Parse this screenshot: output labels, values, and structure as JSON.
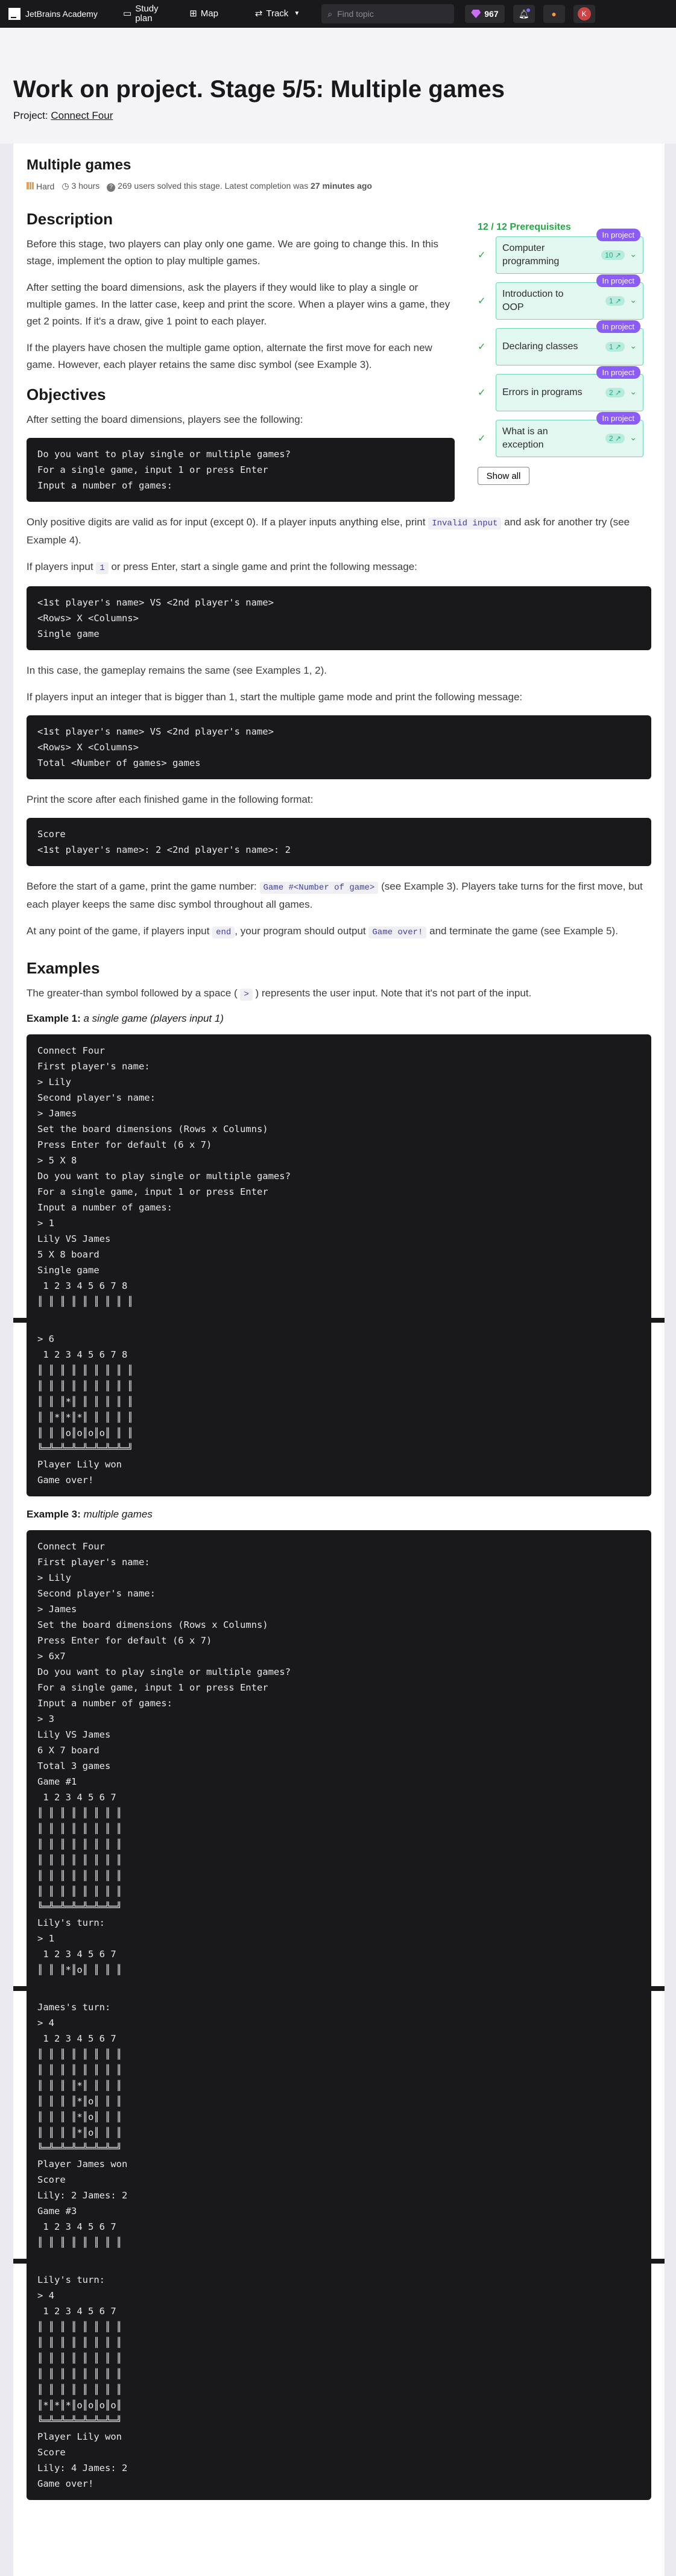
{
  "topbar": {
    "logo": "JetBrains Academy",
    "nav": [
      {
        "icon": "book-icon",
        "label": "Study plan"
      },
      {
        "icon": "grid-icon",
        "label": "Map"
      },
      {
        "icon": "track-icon",
        "label": "Track"
      }
    ],
    "search_placeholder": "Find topic",
    "gems": "967"
  },
  "header": {
    "title": "Work on project. Stage 5/5: Multiple games",
    "project_prefix": "Project:",
    "project_link": "Connect Four"
  },
  "stage": {
    "title": "Multiple games",
    "difficulty": "Hard",
    "time": "3 hours",
    "solved": "269 users solved this stage. Latest completion was",
    "latest": "27 minutes ago"
  },
  "prereq": {
    "title": "12 / 12 Prerequisites",
    "items": [
      {
        "name": "Computer programming",
        "tag": "In project",
        "pill": "10 ↗"
      },
      {
        "name": "Introduction to OOP",
        "tag": "In project",
        "pill": "1 ↗"
      },
      {
        "name": "Declaring classes",
        "tag": "In project",
        "pill": "1 ↗"
      },
      {
        "name": "Errors in programs",
        "tag": "In project",
        "pill": "2 ↗"
      },
      {
        "name": "What is an exception",
        "tag": "In project",
        "pill": "2 ↗"
      }
    ],
    "show_all": "Show all"
  },
  "description": {
    "heading": "Description",
    "p1": "Before this stage, two players can play only one game. We are going to change this. In this stage, implement the option to play multiple games.",
    "p2": "After setting the board dimensions, ask the players if they would like to play a single or multiple games. In the latter case, keep and print the score. When a player wins a game, they get 2 points. If it's a draw, give 1 point to each player.",
    "p3": "If the players have chosen the multiple game option, alternate the first move for each new game. However, each player retains the same disc symbol (see Example 3)."
  },
  "objectives": {
    "heading": "Objectives",
    "p1": "After setting the board dimensions, players see the following:",
    "code1": "Do you want to play single or multiple games?\nFor a single game, input 1 or press Enter\nInput a number of games:",
    "p2a": "Only positive digits are valid as for input (except 0). If a player inputs anything else, print",
    "p2code": "Invalid input",
    "p2b": "and ask for another try (see Example 4).",
    "p3a": "If players input",
    "p3code": "1",
    "p3b": "or press Enter, start a single game and print the following message:",
    "code2": "<1st player's name> VS <2nd player's name>\n<Rows> X <Columns>\nSingle game",
    "p4": "In this case, the gameplay remains the same (see Examples 1, 2).",
    "p5": "If players input an integer that is bigger than 1, start the multiple game mode and print the following message:",
    "code3": "<1st player's name> VS <2nd player's name>\n<Rows> X <Columns>\nTotal <Number of games> games",
    "p6": "Print the score after each finished game in the following format:",
    "code4": "Score\n<1st player's name>: 2 <2nd player's name>: 2",
    "p7a": "Before the start of a game, print the game number:",
    "p7code": "Game #<Number of game>",
    "p7b": "(see Example 3). Players take turns for the first move, but each player keeps the same disc symbol throughout all games.",
    "p8a": "At any point of the game, if players input",
    "p8code": "end",
    "p8b": ", your program should output",
    "p8code2": "Game over!",
    "p8c": "and terminate the game (see Example 5)."
  },
  "examples": {
    "heading": "Examples",
    "p1a": "The greater-than symbol followed by a space (",
    "p1code": ">",
    "p1b": ") represents the user input. Note that it's not part of the input.",
    "ex1_label": "Example 1:",
    "ex1_desc": "a single game (players input 1)",
    "ex1_code_a": "Connect Four\nFirst player's name:\n> Lily\nSecond player's name:\n> James\nSet the board dimensions (Rows x Columns)\nPress Enter for default (6 x 7)\n> 5 X 8\nDo you want to play single or multiple games?\nFor a single game, input 1 or press Enter\nInput a number of games:\n> 1\nLily VS James\n5 X 8 board\nSingle game\n 1 2 3 4 5 6 7 8\n║ ║ ║ ║ ║ ║ ║ ║ ║",
    "ex1_code_b": "> 6\n 1 2 3 4 5 6 7 8\n║ ║ ║ ║ ║ ║ ║ ║ ║\n║ ║ ║ ║ ║ ║ ║ ║ ║\n║ ║ ║*║ ║ ║ ║ ║ ║\n║ ║*║*║*║ ║ ║ ║ ║\n║ ║ ║o║o║o║o║ ║ ║\n╚═╩═╩═╩═╩═╩═╩═╩═╝\nPlayer Lily won\nGame over!",
    "ex3_label": "Example 3:",
    "ex3_desc": "multiple games",
    "ex3_code_a": "Connect Four\nFirst player's name:\n> Lily\nSecond player's name:\n> James\nSet the board dimensions (Rows x Columns)\nPress Enter for default (6 x 7)\n> 6x7\nDo you want to play single or multiple games?\nFor a single game, input 1 or press Enter\nInput a number of games:\n> 3\nLily VS James\n6 X 7 board\nTotal 3 games\nGame #1\n 1 2 3 4 5 6 7\n║ ║ ║ ║ ║ ║ ║ ║\n║ ║ ║ ║ ║ ║ ║ ║\n║ ║ ║ ║ ║ ║ ║ ║\n║ ║ ║ ║ ║ ║ ║ ║\n║ ║ ║ ║ ║ ║ ║ ║\n║ ║ ║ ║ ║ ║ ║ ║\n╚═╩═╩═╩═╩═╩═╩═╝\nLily's turn:\n> 1\n 1 2 3 4 5 6 7\n║ ║ ║*║o║ ║ ║ ║",
    "ex3_code_b": "James's turn:\n> 4\n 1 2 3 4 5 6 7\n║ ║ ║ ║ ║ ║ ║ ║\n║ ║ ║ ║ ║ ║ ║ ║\n║ ║ ║ ║*║ ║ ║ ║\n║ ║ ║ ║*║o║ ║ ║\n║ ║ ║ ║*║o║ ║ ║\n║ ║ ║ ║*║o║ ║ ║\n╚═╩═╩═╩═╩═╩═╩═╝\nPlayer James won\nScore\nLily: 2 James: 2\nGame #3\n 1 2 3 4 5 6 7\n║ ║ ║ ║ ║ ║ ║ ║",
    "ex3_code_c": "Lily's turn:\n> 4\n 1 2 3 4 5 6 7\n║ ║ ║ ║ ║ ║ ║ ║\n║ ║ ║ ║ ║ ║ ║ ║\n║ ║ ║ ║ ║ ║ ║ ║\n║ ║ ║ ║ ║ ║ ║ ║\n║ ║ ║ ║ ║ ║ ║ ║\n║*║*║*║o║o║o║o║\n╚═╩═╩═╩═╩═╩═╩═╝\nPlayer Lily won\nScore\nLily: 4 James: 2\nGame over!"
  }
}
